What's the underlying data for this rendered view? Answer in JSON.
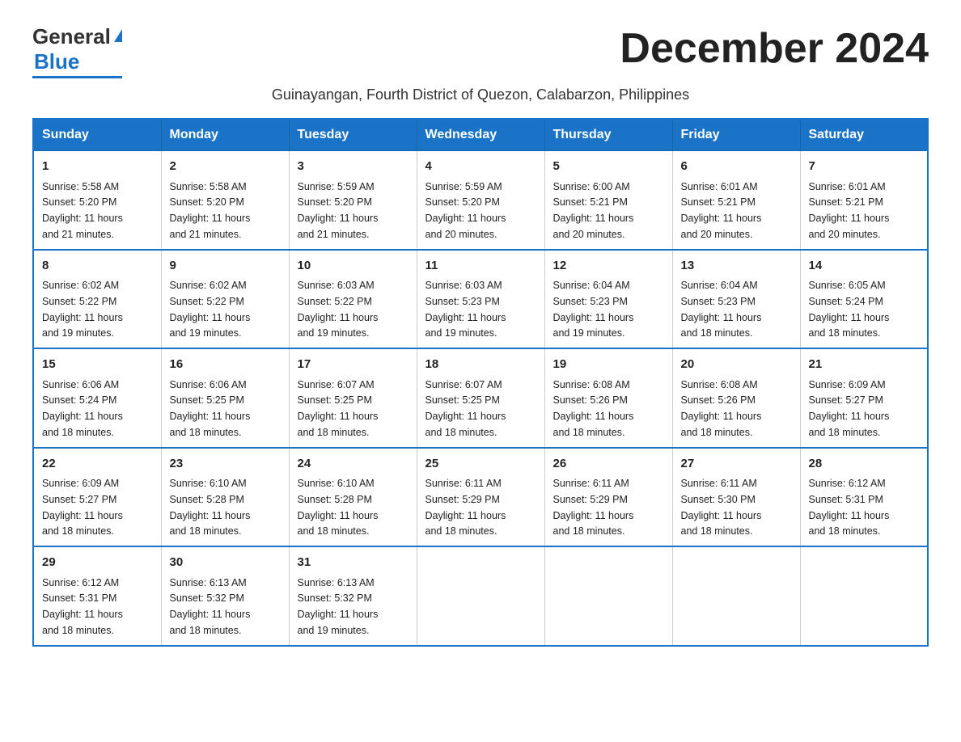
{
  "header": {
    "logo_text_black": "General",
    "logo_text_blue": "Blue",
    "title": "December 2024",
    "subtitle": "Guinayangan, Fourth District of Quezon, Calabarzon, Philippines"
  },
  "days_of_week": [
    "Sunday",
    "Monday",
    "Tuesday",
    "Wednesday",
    "Thursday",
    "Friday",
    "Saturday"
  ],
  "weeks": [
    [
      {
        "day": "1",
        "sunrise": "5:58 AM",
        "sunset": "5:20 PM",
        "daylight": "11 hours and 21 minutes."
      },
      {
        "day": "2",
        "sunrise": "5:58 AM",
        "sunset": "5:20 PM",
        "daylight": "11 hours and 21 minutes."
      },
      {
        "day": "3",
        "sunrise": "5:59 AM",
        "sunset": "5:20 PM",
        "daylight": "11 hours and 21 minutes."
      },
      {
        "day": "4",
        "sunrise": "5:59 AM",
        "sunset": "5:20 PM",
        "daylight": "11 hours and 20 minutes."
      },
      {
        "day": "5",
        "sunrise": "6:00 AM",
        "sunset": "5:21 PM",
        "daylight": "11 hours and 20 minutes."
      },
      {
        "day": "6",
        "sunrise": "6:01 AM",
        "sunset": "5:21 PM",
        "daylight": "11 hours and 20 minutes."
      },
      {
        "day": "7",
        "sunrise": "6:01 AM",
        "sunset": "5:21 PM",
        "daylight": "11 hours and 20 minutes."
      }
    ],
    [
      {
        "day": "8",
        "sunrise": "6:02 AM",
        "sunset": "5:22 PM",
        "daylight": "11 hours and 19 minutes."
      },
      {
        "day": "9",
        "sunrise": "6:02 AM",
        "sunset": "5:22 PM",
        "daylight": "11 hours and 19 minutes."
      },
      {
        "day": "10",
        "sunrise": "6:03 AM",
        "sunset": "5:22 PM",
        "daylight": "11 hours and 19 minutes."
      },
      {
        "day": "11",
        "sunrise": "6:03 AM",
        "sunset": "5:23 PM",
        "daylight": "11 hours and 19 minutes."
      },
      {
        "day": "12",
        "sunrise": "6:04 AM",
        "sunset": "5:23 PM",
        "daylight": "11 hours and 19 minutes."
      },
      {
        "day": "13",
        "sunrise": "6:04 AM",
        "sunset": "5:23 PM",
        "daylight": "11 hours and 18 minutes."
      },
      {
        "day": "14",
        "sunrise": "6:05 AM",
        "sunset": "5:24 PM",
        "daylight": "11 hours and 18 minutes."
      }
    ],
    [
      {
        "day": "15",
        "sunrise": "6:06 AM",
        "sunset": "5:24 PM",
        "daylight": "11 hours and 18 minutes."
      },
      {
        "day": "16",
        "sunrise": "6:06 AM",
        "sunset": "5:25 PM",
        "daylight": "11 hours and 18 minutes."
      },
      {
        "day": "17",
        "sunrise": "6:07 AM",
        "sunset": "5:25 PM",
        "daylight": "11 hours and 18 minutes."
      },
      {
        "day": "18",
        "sunrise": "6:07 AM",
        "sunset": "5:25 PM",
        "daylight": "11 hours and 18 minutes."
      },
      {
        "day": "19",
        "sunrise": "6:08 AM",
        "sunset": "5:26 PM",
        "daylight": "11 hours and 18 minutes."
      },
      {
        "day": "20",
        "sunrise": "6:08 AM",
        "sunset": "5:26 PM",
        "daylight": "11 hours and 18 minutes."
      },
      {
        "day": "21",
        "sunrise": "6:09 AM",
        "sunset": "5:27 PM",
        "daylight": "11 hours and 18 minutes."
      }
    ],
    [
      {
        "day": "22",
        "sunrise": "6:09 AM",
        "sunset": "5:27 PM",
        "daylight": "11 hours and 18 minutes."
      },
      {
        "day": "23",
        "sunrise": "6:10 AM",
        "sunset": "5:28 PM",
        "daylight": "11 hours and 18 minutes."
      },
      {
        "day": "24",
        "sunrise": "6:10 AM",
        "sunset": "5:28 PM",
        "daylight": "11 hours and 18 minutes."
      },
      {
        "day": "25",
        "sunrise": "6:11 AM",
        "sunset": "5:29 PM",
        "daylight": "11 hours and 18 minutes."
      },
      {
        "day": "26",
        "sunrise": "6:11 AM",
        "sunset": "5:29 PM",
        "daylight": "11 hours and 18 minutes."
      },
      {
        "day": "27",
        "sunrise": "6:11 AM",
        "sunset": "5:30 PM",
        "daylight": "11 hours and 18 minutes."
      },
      {
        "day": "28",
        "sunrise": "6:12 AM",
        "sunset": "5:31 PM",
        "daylight": "11 hours and 18 minutes."
      }
    ],
    [
      {
        "day": "29",
        "sunrise": "6:12 AM",
        "sunset": "5:31 PM",
        "daylight": "11 hours and 18 minutes."
      },
      {
        "day": "30",
        "sunrise": "6:13 AM",
        "sunset": "5:32 PM",
        "daylight": "11 hours and 18 minutes."
      },
      {
        "day": "31",
        "sunrise": "6:13 AM",
        "sunset": "5:32 PM",
        "daylight": "11 hours and 19 minutes."
      },
      null,
      null,
      null,
      null
    ]
  ],
  "labels": {
    "sunrise": "Sunrise:",
    "sunset": "Sunset:",
    "daylight": "Daylight:"
  }
}
